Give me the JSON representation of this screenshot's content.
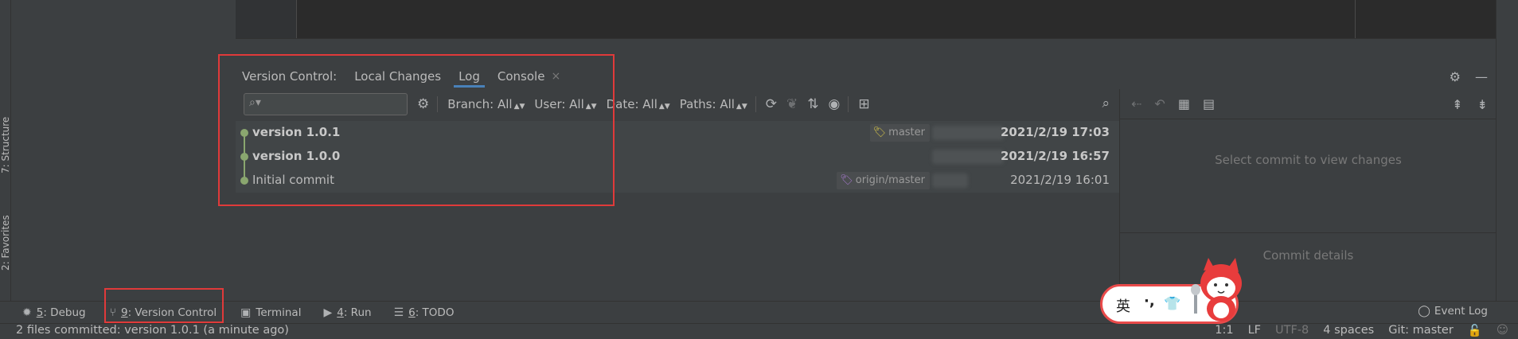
{
  "left_tabs": {
    "structure": "7: Structure",
    "favorites": "2: Favorites"
  },
  "panel": {
    "title": "Version Control:",
    "tabs": [
      {
        "label": "Local Changes",
        "active": false
      },
      {
        "label": "Log",
        "active": true
      },
      {
        "label": "Console",
        "active": false,
        "closable": true
      }
    ],
    "close_glyph": "×"
  },
  "toolbar": {
    "search_placeholder": "",
    "filters": [
      {
        "label": "Branch: All"
      },
      {
        "label": "User: All"
      },
      {
        "label": "Date: All"
      },
      {
        "label": "Paths: All"
      }
    ]
  },
  "log": {
    "commits": [
      {
        "message": "version 1.0.1",
        "bold": true,
        "ref": "master",
        "ref_color": "#d4c44a",
        "date": "2021/2/19 17:03"
      },
      {
        "message": "version 1.0.0",
        "bold": true,
        "ref": "",
        "date": "2021/2/19 16:57"
      },
      {
        "message": "Initial commit",
        "bold": false,
        "ref": "origin/master",
        "ref_color": "#a377c9",
        "date": "2021/2/19 16:01"
      }
    ],
    "graph_color": "#8aa66f"
  },
  "details": {
    "empty_changes": "Select commit to view changes",
    "empty_details": "Commit details"
  },
  "bottom_tabs": [
    {
      "key": "5",
      "label": ": Debug",
      "icon": "debug-icon"
    },
    {
      "key": "9",
      "label": ": Version Control",
      "icon": "vcs-branch-icon"
    },
    {
      "key": "",
      "label": "Terminal",
      "icon": "terminal-icon"
    },
    {
      "key": "4",
      "label": ": Run",
      "icon": "run-icon"
    },
    {
      "key": "6",
      "label": ": TODO",
      "icon": "todo-icon"
    }
  ],
  "event_log": "Event Log",
  "status": {
    "message": "2 files committed: version 1.0.1 (a minute ago)",
    "position": "1:1",
    "line_sep": "LF",
    "encoding": "UTF-8",
    "indent": "4 spaces",
    "branch": "Git: master"
  },
  "ime": {
    "char": "英"
  },
  "colors": {
    "highlight": "#e03a3a",
    "background": "#3c3f41"
  }
}
